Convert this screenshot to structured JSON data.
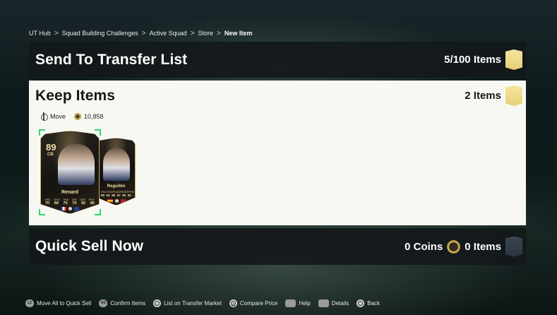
{
  "breadcrumb": {
    "items": [
      "UT Hub",
      "Squad Building Challenges",
      "Active Squad",
      "Store"
    ],
    "current": "New Item",
    "separator": ">"
  },
  "transfer_list": {
    "title": "Send To Transfer List",
    "count": "5/100 Items"
  },
  "keep_items": {
    "title": "Keep Items",
    "count": "2 Items",
    "move_label": "Move",
    "coins": "10,858"
  },
  "cards": [
    {
      "rating": "89",
      "position": "CB",
      "name": "Renard",
      "stat_labels": [
        "PAC",
        "SHO",
        "PAS",
        "DRI",
        "DEF",
        "PHY"
      ],
      "stat_values": [
        "70",
        "68",
        "70",
        "70",
        "92",
        "85"
      ]
    },
    {
      "name": "Reguilón",
      "stat_labels": [
        "PAC",
        "SHO",
        "PAS",
        "DRI",
        "DEF",
        "PHY"
      ],
      "stat_values": [
        "80",
        "63",
        "80",
        "67",
        "80",
        "81"
      ]
    }
  ],
  "quick_sell": {
    "title": "Quick Sell Now",
    "coins": "0 Coins",
    "count": "0 Items"
  },
  "footer": {
    "hints": [
      {
        "button": "L2",
        "label": "Move All to Quick Sell"
      },
      {
        "button": "R2",
        "label": "Confirm Items"
      },
      {
        "button": "square",
        "label": "List on Transfer Market"
      },
      {
        "button": "triangle",
        "label": "Compare Price"
      },
      {
        "button": "pad",
        "label": "Help"
      },
      {
        "button": "pad",
        "label": "Details"
      },
      {
        "button": "circle",
        "label": "Back"
      }
    ]
  },
  "colors": {
    "selection": "#2bd96b",
    "gold_card": "#e7cf74",
    "keep_panel_bg": "#f8f8f3"
  }
}
